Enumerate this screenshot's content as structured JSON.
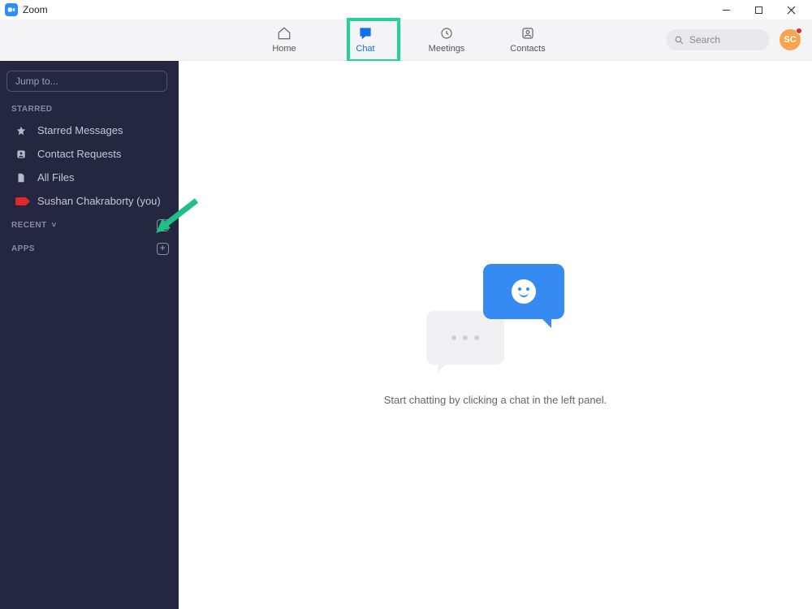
{
  "window": {
    "title": "Zoom"
  },
  "nav": {
    "home": "Home",
    "chat": "Chat",
    "meetings": "Meetings",
    "contacts": "Contacts"
  },
  "search": {
    "placeholder": "Search"
  },
  "avatar": {
    "initials": "SC"
  },
  "sidebar": {
    "jump_placeholder": "Jump to...",
    "sections": {
      "starred": "STARRED",
      "recent": "RECENT",
      "apps": "APPS"
    },
    "items": {
      "starred_messages": "Starred Messages",
      "contact_requests": "Contact Requests",
      "all_files": "All Files",
      "self_chat": "Sushan Chakraborty (you)"
    }
  },
  "main": {
    "empty_state": "Start chatting by clicking a chat in the left panel."
  },
  "colors": {
    "accent": "#2D8CFF",
    "annotation": "#23d19a",
    "sidebar_bg": "#25263f"
  }
}
